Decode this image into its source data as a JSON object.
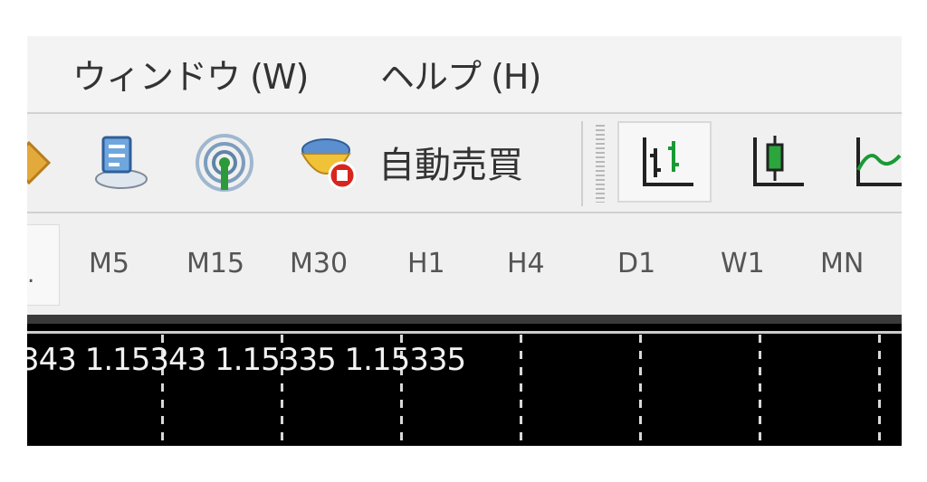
{
  "menu": {
    "items": [
      {
        "label": "ウィンドウ (W)"
      },
      {
        "label": "ヘルプ (H)"
      }
    ]
  },
  "toolbar": {
    "icons": [
      "favorite-icon",
      "market-watch-icon",
      "signals-icon",
      "auto-trading-icon"
    ],
    "auto_trading_label": "自動売買",
    "chart_type_icons": [
      "bar-chart-icon",
      "candlestick-chart-icon",
      "line-chart-icon"
    ]
  },
  "timeframes": {
    "items": [
      "M5",
      "M15",
      "M30",
      "H1",
      "H4",
      "D1",
      "W1",
      "MN"
    ]
  },
  "chart": {
    "price_line": "343 1.15343 1.15335 1.15335"
  }
}
